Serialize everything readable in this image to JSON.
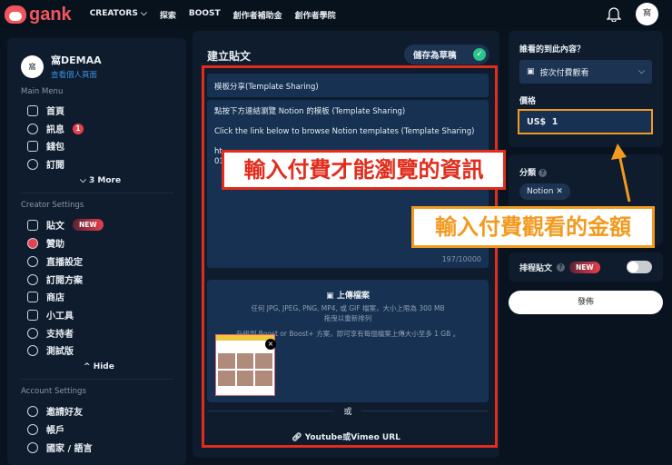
{
  "topbar": {
    "logo": "gank",
    "nav": [
      "CREATORS",
      "探索",
      "BOOST",
      "創作者補助金",
      "創作者學院"
    ],
    "avatar": "窩"
  },
  "sidebar": {
    "name": "窩DEMAA",
    "profile_link": "查看個人頁面",
    "avatar": "窩",
    "main_menu_title": "Main Menu",
    "main_items": [
      {
        "label": "首頁"
      },
      {
        "label": "訊息",
        "badge": "1"
      },
      {
        "label": "錢包"
      },
      {
        "label": "訂閱"
      }
    ],
    "more": "3 More",
    "creator_title": "Creator Settings",
    "creator_items": [
      {
        "label": "貼文",
        "badge": "NEW"
      },
      {
        "label": "贊助"
      },
      {
        "label": "直播設定"
      },
      {
        "label": "訂閱方案"
      },
      {
        "label": "商店"
      },
      {
        "label": "小工具"
      },
      {
        "label": "支持者"
      },
      {
        "label": "測試版"
      }
    ],
    "hide": "Hide",
    "account_title": "Account Settings",
    "account_items": [
      {
        "label": "邀請好友"
      },
      {
        "label": "帳戶"
      },
      {
        "label": "國家 / 語言"
      }
    ]
  },
  "main": {
    "title": "建立貼文",
    "save_draft": "儲存為草稿",
    "post_title": "模板分享(Template Sharing)",
    "body_lines": [
      "點按下方連結瀏覽 Notion 的模板 (Template Sharing)",
      "Click the link below to browse Notion templates (Template Sharing)",
      "ht",
      "01"
    ],
    "char_count": "197/10000",
    "upload_title": "上傳檔案",
    "upload_desc": "任何 JPG, JPEG, PNG, MP4, 或 GIF 檔案，大小上限為 300 MB",
    "upload_reorder": "拖曳以重新排列",
    "upload_upgrade": "升級到 Boost or Boost+ 方案，即可享有每個檔案上傳大小至多 1 GB 。",
    "or": "或",
    "video_url": "Youtube或Vimeo URL"
  },
  "right": {
    "who_label": "誰看的到此內容？",
    "who_value": "按次付費觀看",
    "price_label": "價格",
    "price_currency": "US$",
    "price_value": "1",
    "category_label": "分類",
    "category_chip": "Notion",
    "schedule_label": "排程貼文",
    "schedule_badge": "NEW",
    "publish": "發佈"
  },
  "annotations": {
    "paid_content": "輸入付費才能瀏覽的資訊",
    "paid_amount": "輸入付費觀看的金額"
  },
  "colors": {
    "accent": "#f2555e",
    "annotation_red": "#e22c1c",
    "annotation_orange": "#f29a1f"
  }
}
